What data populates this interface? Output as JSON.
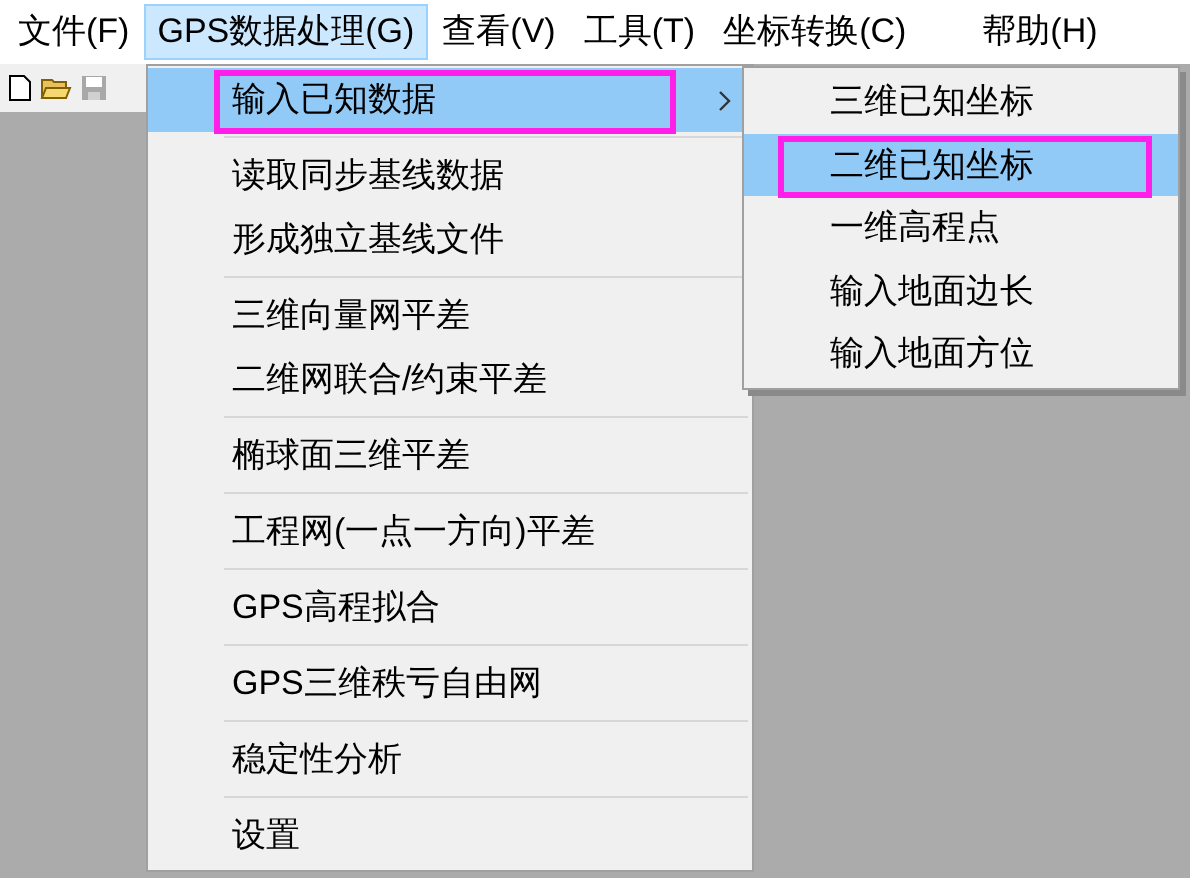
{
  "menubar": [
    {
      "label": "文件(F)",
      "selected": false
    },
    {
      "label": "GPS数据处理(G)",
      "selected": true
    },
    {
      "label": "查看(V)",
      "selected": false
    },
    {
      "label": "工具(T)",
      "selected": false
    },
    {
      "label": "坐标转换(C)",
      "selected": false
    },
    {
      "label": "帮助(H)",
      "selected": false
    }
  ],
  "toolbar": [
    {
      "kind": "new",
      "disabled": false
    },
    {
      "kind": "open",
      "disabled": false
    },
    {
      "kind": "save",
      "disabled": true
    }
  ],
  "menu": {
    "groups": [
      [
        {
          "label": "输入已知数据",
          "selected": true,
          "highlighted": true,
          "submenu": true
        }
      ],
      [
        {
          "label": "读取同步基线数据",
          "selected": false,
          "highlighted": false,
          "submenu": false
        },
        {
          "label": "形成独立基线文件",
          "selected": false,
          "highlighted": false,
          "submenu": false
        }
      ],
      [
        {
          "label": "三维向量网平差",
          "selected": false,
          "highlighted": false,
          "submenu": false
        },
        {
          "label": "二维网联合/约束平差",
          "selected": false,
          "highlighted": false,
          "submenu": false
        }
      ],
      [
        {
          "label": "椭球面三维平差",
          "selected": false,
          "highlighted": false,
          "submenu": false
        }
      ],
      [
        {
          "label": "工程网(一点一方向)平差",
          "selected": false,
          "highlighted": false,
          "submenu": false
        }
      ],
      [
        {
          "label": "GPS高程拟合",
          "selected": false,
          "highlighted": false,
          "submenu": false
        }
      ],
      [
        {
          "label": "GPS三维秩亏自由网",
          "selected": false,
          "highlighted": false,
          "submenu": false
        }
      ],
      [
        {
          "label": "稳定性分析",
          "selected": false,
          "highlighted": false,
          "submenu": false
        }
      ],
      [
        {
          "label": "设置",
          "selected": false,
          "highlighted": false,
          "submenu": false
        }
      ]
    ]
  },
  "submenu": {
    "items": [
      {
        "label": "三维已知坐标",
        "selected": false,
        "highlighted": false
      },
      {
        "label": "二维已知坐标",
        "selected": true,
        "highlighted": true
      },
      {
        "label": "一维高程点",
        "selected": false,
        "highlighted": false
      },
      {
        "label": "输入地面边长",
        "selected": false,
        "highlighted": false
      },
      {
        "label": "输入地面方位",
        "selected": false,
        "highlighted": false
      }
    ]
  }
}
